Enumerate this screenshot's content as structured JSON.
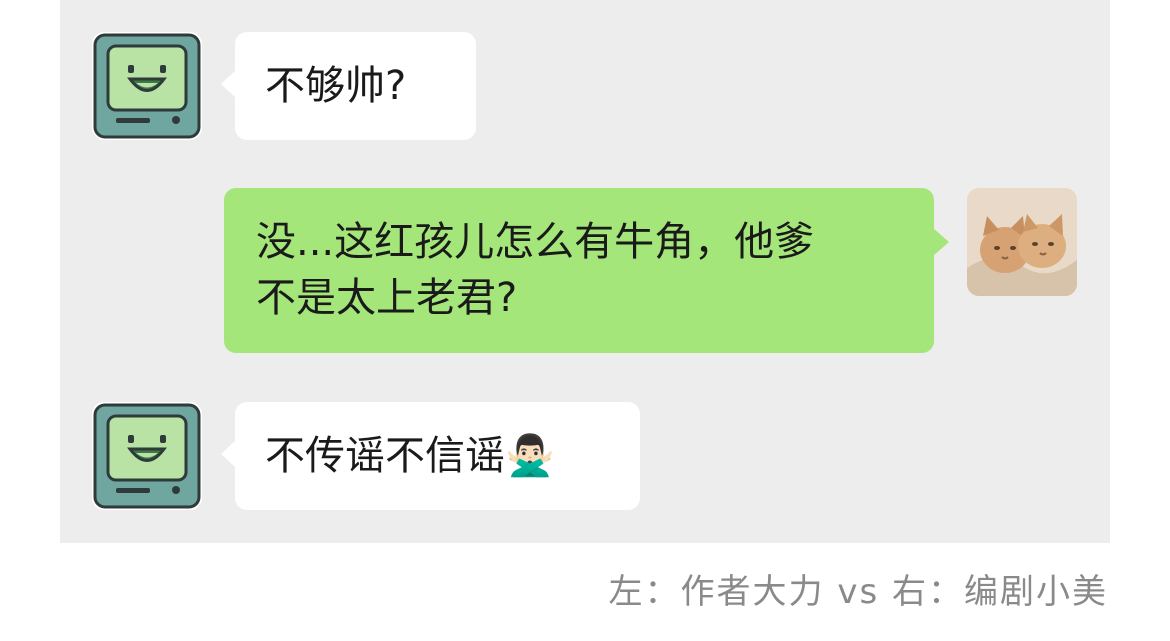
{
  "conversation": {
    "messages": [
      {
        "side": "left",
        "sender_avatar": "bmo-robot-avatar",
        "text": "不够帅?"
      },
      {
        "side": "right",
        "sender_avatar": "cats-avatar",
        "text": "没...这红孩儿怎么有牛角，他爹\n不是太上老君?"
      },
      {
        "side": "left",
        "sender_avatar": "bmo-robot-avatar",
        "text": "不传谣不信谣",
        "emoji": "🙅🏻‍♂️"
      }
    ]
  },
  "caption": {
    "left_label": "左：",
    "left_name": "作者大力",
    "vs": "vs",
    "right_label": "右：",
    "right_name": "编剧小美"
  },
  "colors": {
    "chat_background": "#ededed",
    "incoming_bubble": "#ffffff",
    "outgoing_bubble": "#a5e67a",
    "caption_text": "#8a8a8a"
  }
}
